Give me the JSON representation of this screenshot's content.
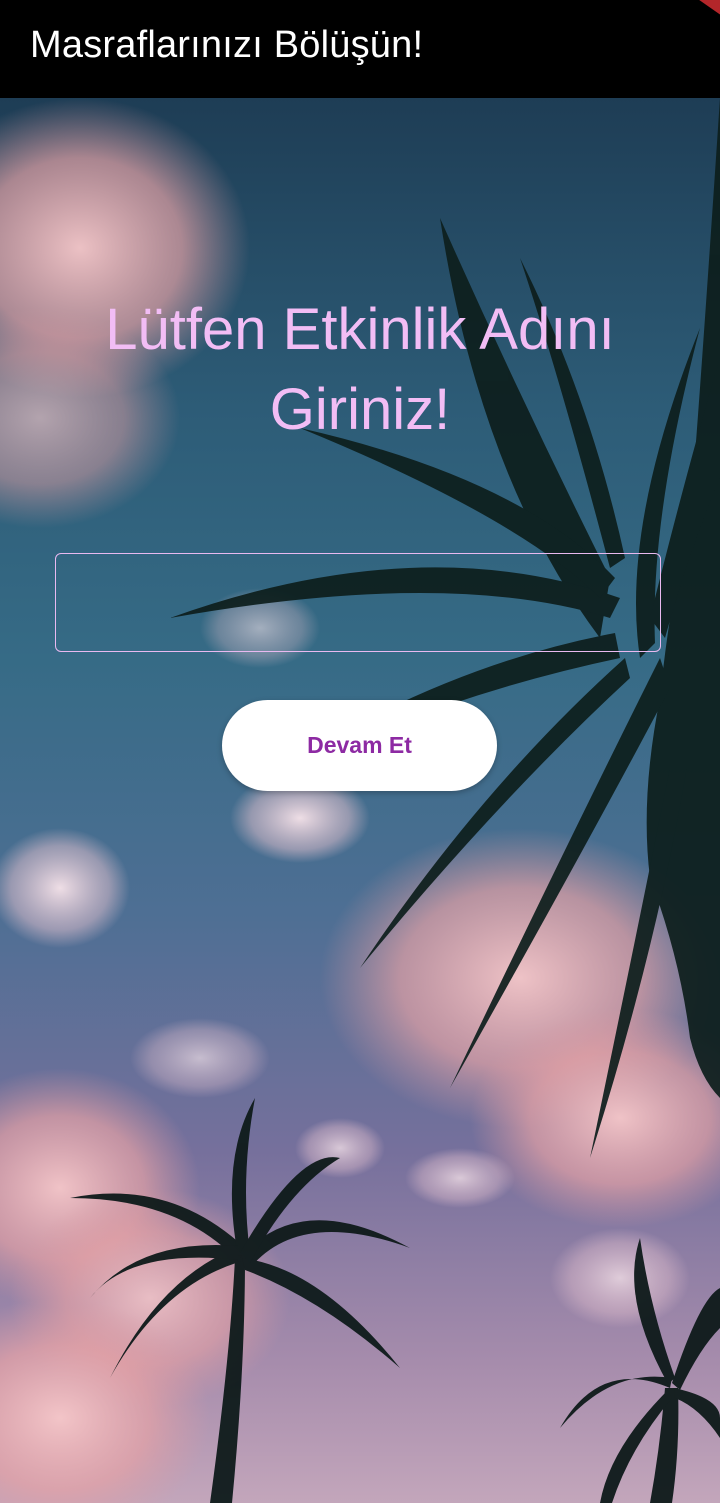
{
  "app_bar": {
    "title": "Masraflarınızı Bölüşün!"
  },
  "main": {
    "heading": "Lütfen Etkinlik Adını Giriniz!",
    "event_name_input": {
      "value": "",
      "placeholder": ""
    },
    "continue_button_label": "Devam Et"
  },
  "background": {
    "description_icon": "palm-trees-sunset-background"
  },
  "colors": {
    "app_bar": "#000000",
    "heading": "#f2bdf5",
    "input_border": "#e9b9f0",
    "button_bg": "#ffffff",
    "button_text": "#8d2aa3",
    "debug_banner": "#b3262a"
  }
}
